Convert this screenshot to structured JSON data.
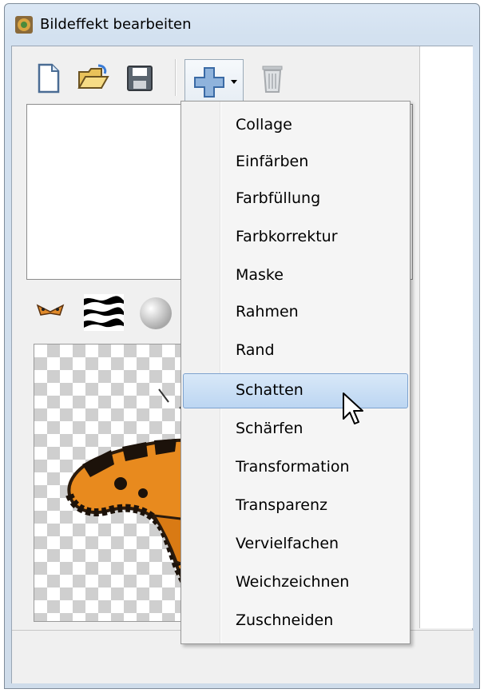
{
  "window": {
    "title": "Bildeffekt bearbeiten"
  },
  "toolbar": {
    "buttons": [
      {
        "name": "new",
        "icon": "new-document-icon"
      },
      {
        "name": "open",
        "icon": "open-folder-icon"
      },
      {
        "name": "save",
        "icon": "floppy-disk-icon"
      },
      {
        "name": "add",
        "icon": "plus-icon"
      },
      {
        "name": "delete",
        "icon": "trash-icon"
      }
    ]
  },
  "thumbnails": [
    "butterfly-icon",
    "zebra-pattern-icon",
    "sphere-icon"
  ],
  "menu": {
    "items": [
      "Collage",
      "Einfärben",
      "Farbfüllung",
      "Farbkorrektur",
      "Maske",
      "Rahmen",
      "Rand",
      "Schatten",
      "Schärfen",
      "Transformation",
      "Transparenz",
      "Vervielfachen",
      "Weichzeichnen",
      "Zuschneiden"
    ],
    "selected": "Schatten"
  },
  "colors": {
    "selection_bg": "#c4dcf5",
    "selection_border": "#7da2ce",
    "checker": "#cfcfcf",
    "accent": "#3d7fd1"
  }
}
